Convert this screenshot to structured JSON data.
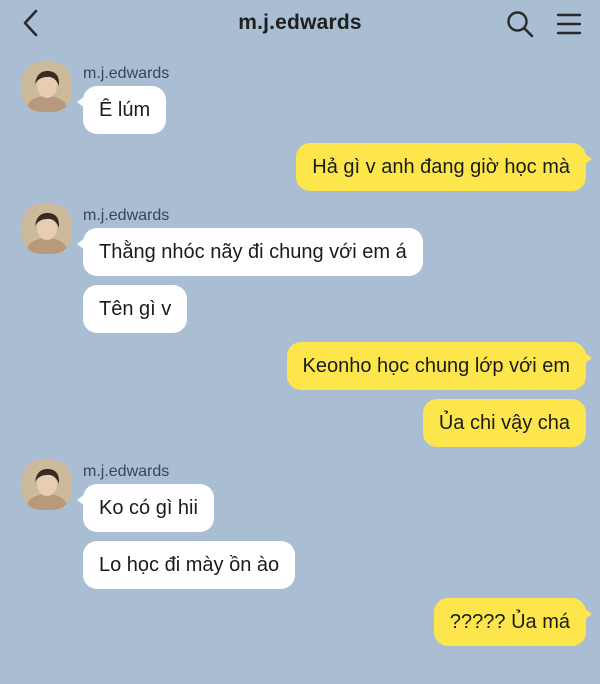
{
  "header": {
    "title": "m.j.edwards",
    "back_icon": "chevron-left-icon",
    "search_icon": "search-icon",
    "menu_icon": "hamburger-menu-icon"
  },
  "colors": {
    "background": "#a9bdd3",
    "incoming_bubble": "#ffffff",
    "outgoing_bubble": "#fde64b"
  },
  "conversation": {
    "sender_name": "m.j.edwards",
    "messages": [
      {
        "direction": "incoming",
        "text": "Ê lúm"
      },
      {
        "direction": "outgoing",
        "text": "Hả gì v anh đang giờ học mà"
      },
      {
        "direction": "incoming",
        "text": "Thằng nhóc nãy đi chung với em á"
      },
      {
        "direction": "incoming",
        "text": "Tên gì v"
      },
      {
        "direction": "outgoing",
        "text": "Keonho học chung lớp với em"
      },
      {
        "direction": "outgoing",
        "text": "Ủa chi vậy cha"
      },
      {
        "direction": "incoming",
        "text": "Ko có gì hii"
      },
      {
        "direction": "incoming",
        "text": "Lo học đi mày ồn ào"
      },
      {
        "direction": "outgoing",
        "text": "????? Ủa má"
      }
    ]
  }
}
